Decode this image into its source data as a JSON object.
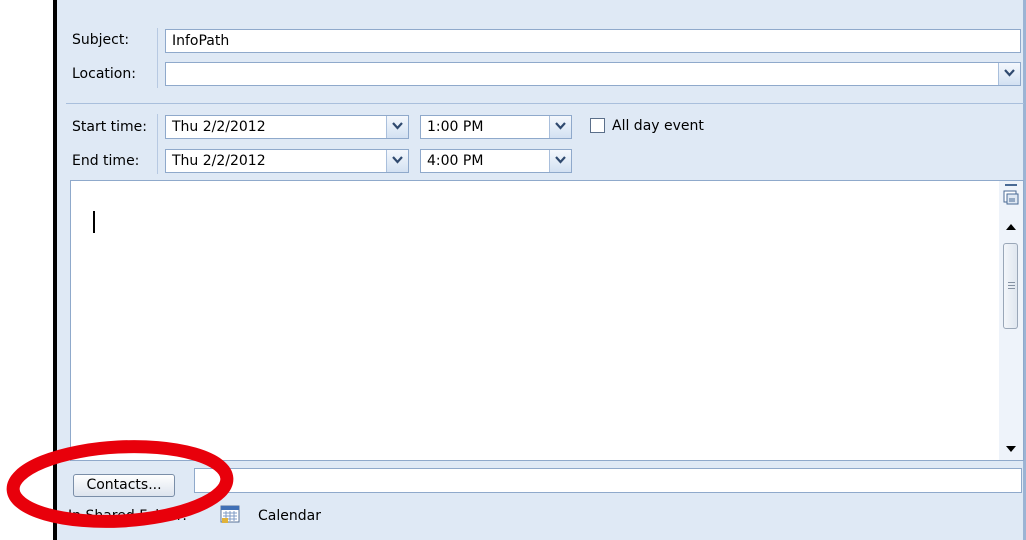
{
  "form": {
    "subject_label": "Subject:",
    "subject_value": "InfoPath",
    "location_label": "Location:",
    "location_value": "",
    "start_label": "Start time:",
    "start_date": "Thu 2/2/2012",
    "start_time": "1:00 PM",
    "all_day_label": "All day event",
    "all_day_checked": false,
    "end_label": "End time:",
    "end_date": "Thu 2/2/2012",
    "end_time": "4:00 PM"
  },
  "body": {
    "text": ""
  },
  "footer": {
    "contacts_button": "Contacts...",
    "contacts_value": "",
    "shared_folder_label": "In Shared Folder:",
    "calendar_label": "Calendar"
  },
  "annotation": {
    "color": "#e8000b"
  },
  "icons": [
    "dropdown-arrow-icon",
    "calendar-icon",
    "format-toggle-icon",
    "scroll-up-icon",
    "scroll-down-icon"
  ]
}
